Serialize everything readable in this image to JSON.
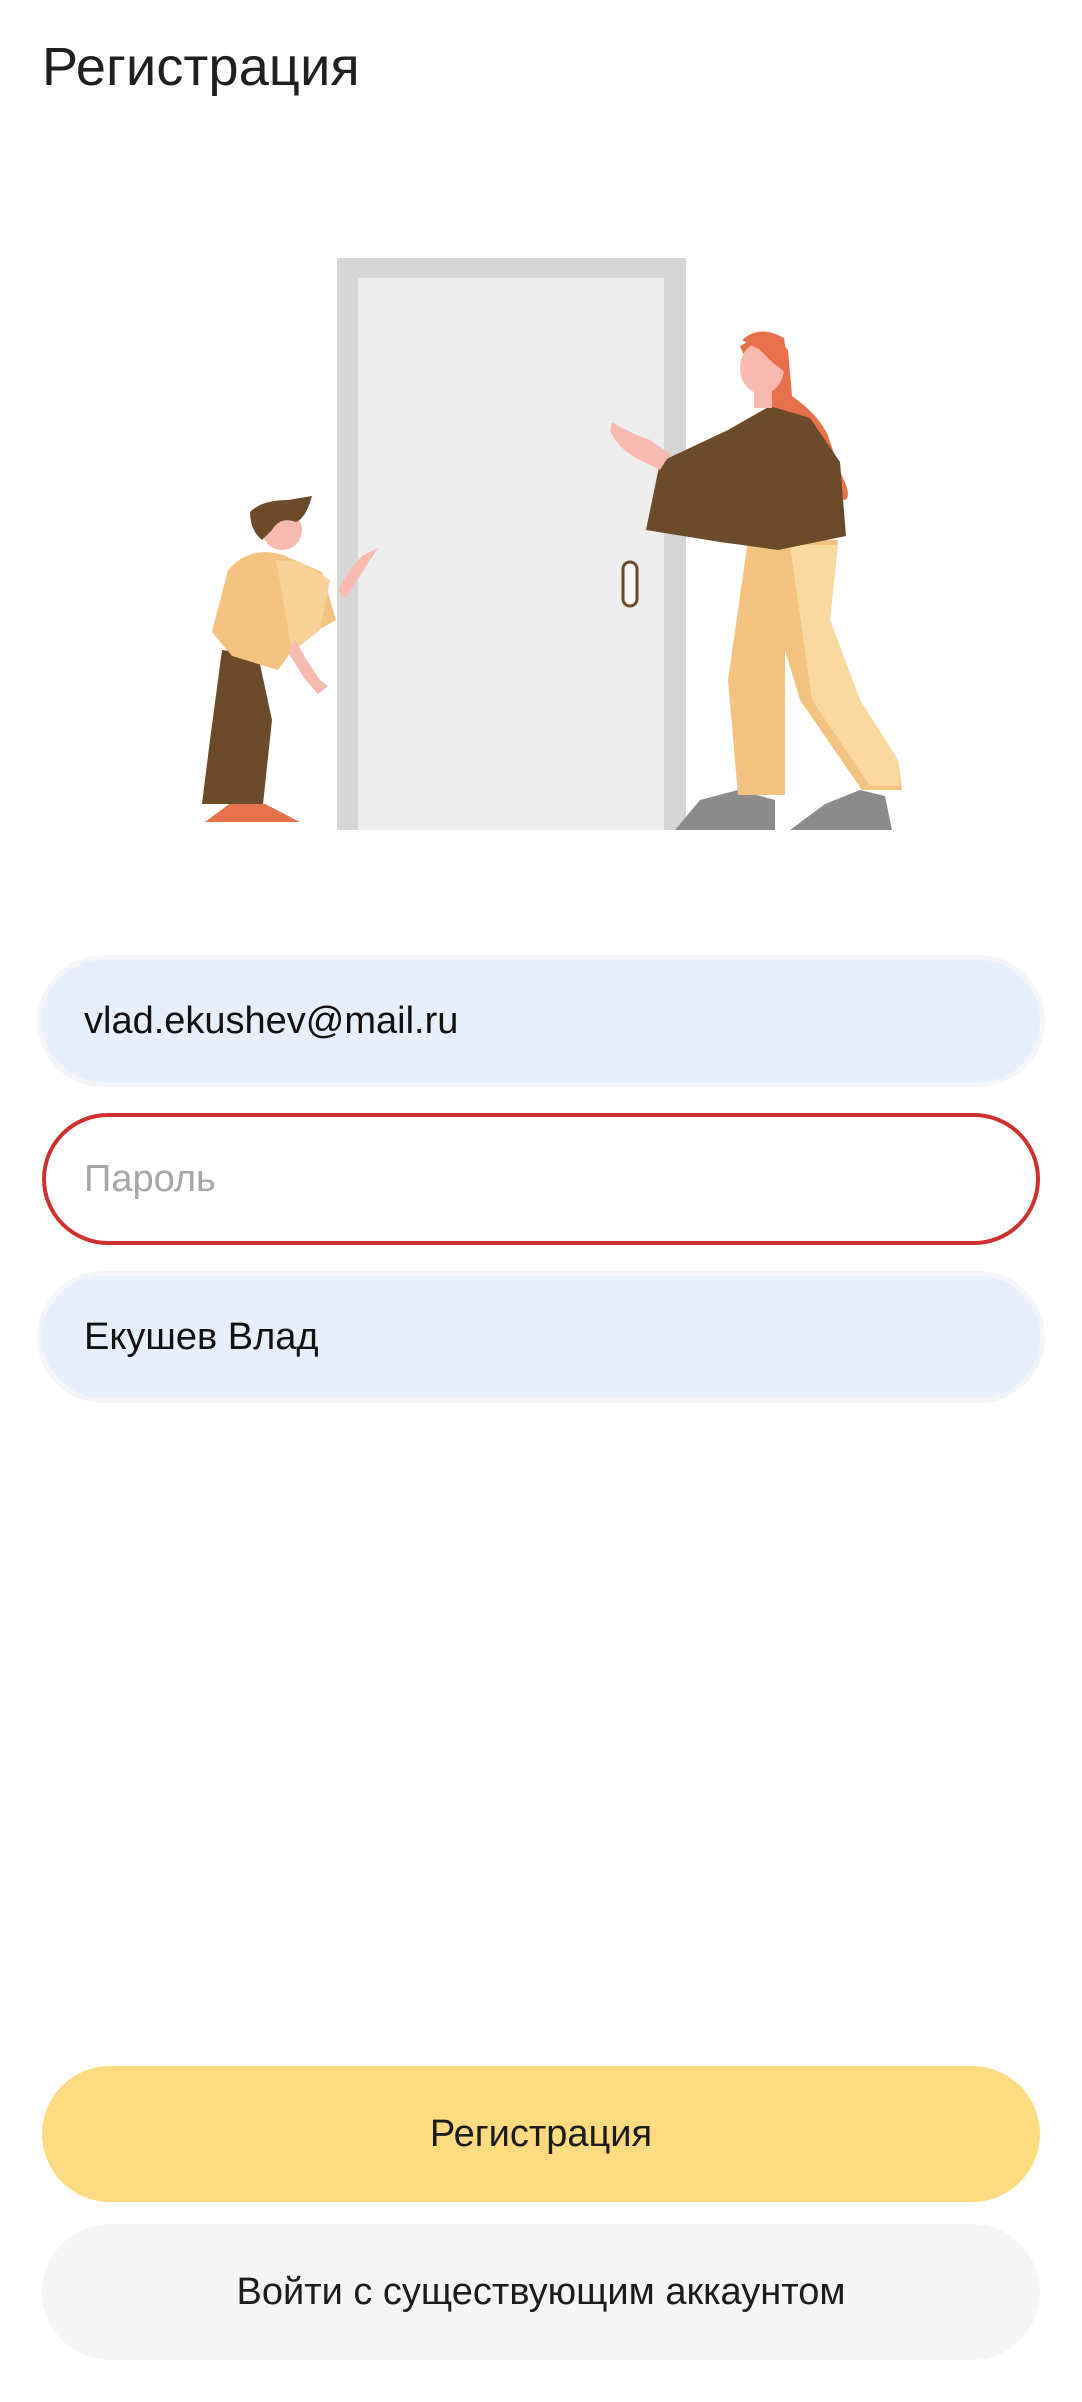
{
  "header": {
    "title": "Регистрация"
  },
  "illustration": {
    "name": "door-illustration"
  },
  "form": {
    "email": {
      "value": "vlad.ekushev@mail.ru"
    },
    "password": {
      "value": "",
      "placeholder": "Пароль"
    },
    "name": {
      "value": "Екушев Влад"
    }
  },
  "actions": {
    "register_label": "Регистрация",
    "login_label": "Войти с существующим аккаунтом"
  },
  "colors": {
    "primary_button": "#fddb80",
    "secondary_button": "#f5f5f5",
    "field_fill": "#e8effc",
    "error_border": "#d0302f"
  }
}
